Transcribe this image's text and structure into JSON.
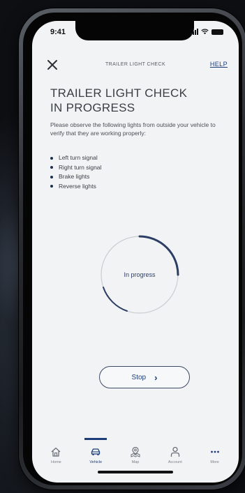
{
  "status_bar": {
    "time": "9:41"
  },
  "nav": {
    "title": "TRAILER LIGHT CHECK",
    "help_label": "HELP"
  },
  "content": {
    "title_line1": "TRAILER LIGHT CHECK",
    "title_line2": "IN PROGRESS",
    "intro": "Please observe the following lights from outside your vehicle to verify that they are working properly:",
    "lights": [
      "Left turn signal",
      "Right turn signal",
      "Brake lights",
      "Reverse lights"
    ],
    "progress_label": "In progress",
    "stop_label": "Stop",
    "stop_icon": "chevron-right-icon"
  },
  "tabs": [
    {
      "label": "Home",
      "icon": "home-icon",
      "active": false
    },
    {
      "label": "Vehicle",
      "icon": "car-icon",
      "active": true
    },
    {
      "label": "Map",
      "icon": "map-icon",
      "active": false
    },
    {
      "label": "Account",
      "icon": "person-icon",
      "active": false
    },
    {
      "label": "More",
      "icon": "more-icon",
      "active": false
    }
  ],
  "colors": {
    "accent": "#1d3d7a",
    "screen_background": "#f2f3f4",
    "text": "#3a3f46"
  }
}
